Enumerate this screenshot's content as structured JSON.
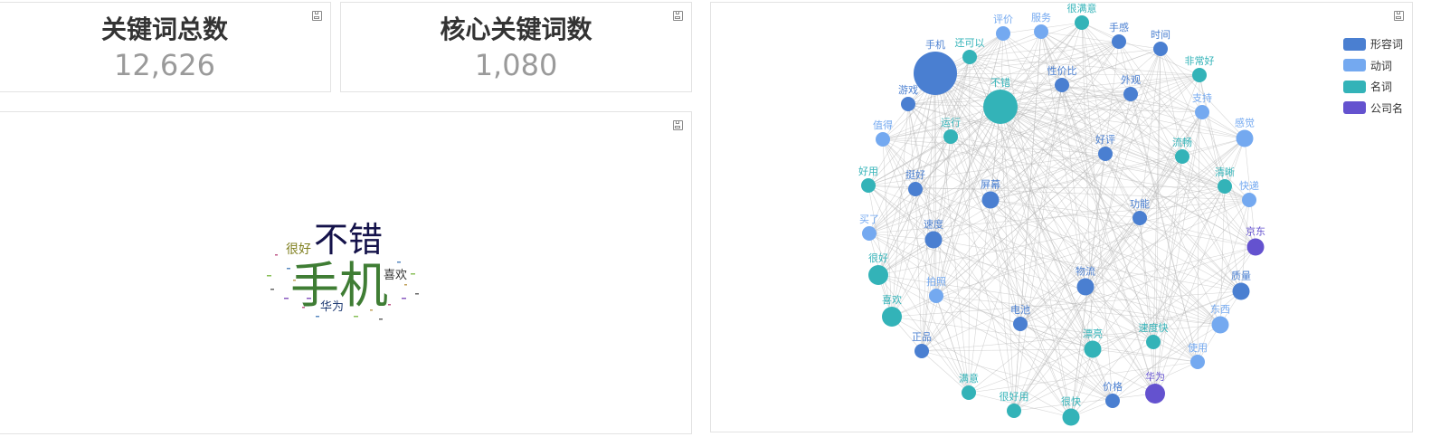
{
  "kpi_total": {
    "title": "关键词总数",
    "value": "12,626"
  },
  "kpi_core": {
    "title": "核心关键词数",
    "value": "1,080"
  },
  "wordcloud": {
    "words": [
      {
        "text": "手机",
        "weight": 100,
        "color": "#3f7d34"
      },
      {
        "text": "不错",
        "weight": 78,
        "color": "#14124a"
      },
      {
        "text": "很好",
        "weight": 30,
        "color": "#7f7f1e"
      },
      {
        "text": "喜欢",
        "weight": 28,
        "color": "#333333"
      },
      {
        "text": "华为",
        "weight": 26,
        "color": "#1f3b73"
      }
    ]
  },
  "chart_data": {
    "type": "network",
    "legend_position": "top-right",
    "categories": [
      {
        "name": "形容词",
        "color": "#4a7fd1"
      },
      {
        "name": "动词",
        "color": "#74a9f0"
      },
      {
        "name": "名词",
        "color": "#33b3b8"
      },
      {
        "name": "公司名",
        "color": "#6452cf"
      }
    ],
    "nodes": [
      {
        "name": "手机",
        "category": 0,
        "weight": 10
      },
      {
        "name": "不错",
        "category": 2,
        "weight": 8
      },
      {
        "name": "评价",
        "category": 1,
        "weight": 2
      },
      {
        "name": "服务",
        "category": 1,
        "weight": 2
      },
      {
        "name": "很满意",
        "category": 2,
        "weight": 2
      },
      {
        "name": "手感",
        "category": 0,
        "weight": 2
      },
      {
        "name": "时间",
        "category": 0,
        "weight": 2
      },
      {
        "name": "还可以",
        "category": 2,
        "weight": 2
      },
      {
        "name": "非常好",
        "category": 2,
        "weight": 2
      },
      {
        "name": "性价比",
        "category": 0,
        "weight": 2
      },
      {
        "name": "游戏",
        "category": 0,
        "weight": 2
      },
      {
        "name": "外观",
        "category": 0,
        "weight": 2
      },
      {
        "name": "支持",
        "category": 1,
        "weight": 2
      },
      {
        "name": "值得",
        "category": 1,
        "weight": 2
      },
      {
        "name": "运行",
        "category": 2,
        "weight": 2
      },
      {
        "name": "感觉",
        "category": 1,
        "weight": 3
      },
      {
        "name": "拍照",
        "category": 1,
        "weight": 2
      },
      {
        "name": "好评",
        "category": 0,
        "weight": 2
      },
      {
        "name": "流畅",
        "category": 2,
        "weight": 2
      },
      {
        "name": "好用",
        "category": 2,
        "weight": 2
      },
      {
        "name": "挺好",
        "category": 0,
        "weight": 2
      },
      {
        "name": "屏幕",
        "category": 0,
        "weight": 3
      },
      {
        "name": "清晰",
        "category": 2,
        "weight": 2
      },
      {
        "name": "快递",
        "category": 1,
        "weight": 2
      },
      {
        "name": "功能",
        "category": 0,
        "weight": 2
      },
      {
        "name": "买了",
        "category": 1,
        "weight": 2
      },
      {
        "name": "速度",
        "category": 0,
        "weight": 3
      },
      {
        "name": "京东",
        "category": 3,
        "weight": 3
      },
      {
        "name": "很好",
        "category": 2,
        "weight": 4
      },
      {
        "name": "东西",
        "category": 1,
        "weight": 3
      },
      {
        "name": "物流",
        "category": 0,
        "weight": 3
      },
      {
        "name": "质量",
        "category": 0,
        "weight": 3
      },
      {
        "name": "喜欢",
        "category": 2,
        "weight": 4
      },
      {
        "name": "电池",
        "category": 0,
        "weight": 2
      },
      {
        "name": "正品",
        "category": 0,
        "weight": 2
      },
      {
        "name": "漂亮",
        "category": 2,
        "weight": 3
      },
      {
        "name": "速度快",
        "category": 2,
        "weight": 2
      },
      {
        "name": "使用",
        "category": 1,
        "weight": 2
      },
      {
        "name": "满意",
        "category": 2,
        "weight": 2
      },
      {
        "name": "很好用",
        "category": 2,
        "weight": 2
      },
      {
        "name": "很快",
        "category": 2,
        "weight": 3
      },
      {
        "name": "价格",
        "category": 0,
        "weight": 2
      },
      {
        "name": "华为",
        "category": 3,
        "weight": 4
      }
    ]
  }
}
